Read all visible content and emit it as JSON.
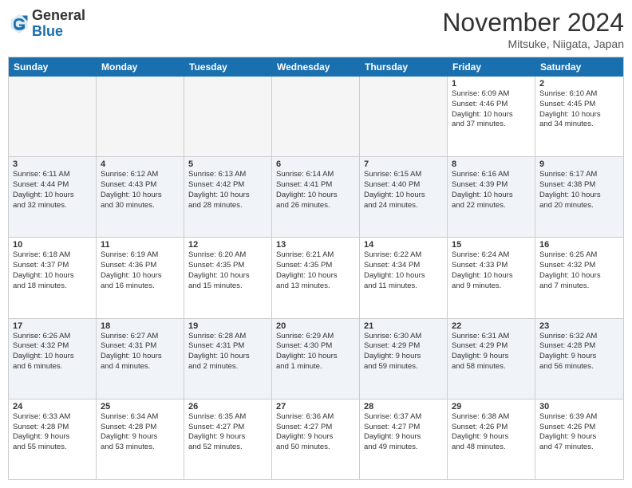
{
  "logo": {
    "general": "General",
    "blue": "Blue"
  },
  "header": {
    "title": "November 2024",
    "subtitle": "Mitsuke, Niigata, Japan"
  },
  "calendar": {
    "days": [
      "Sunday",
      "Monday",
      "Tuesday",
      "Wednesday",
      "Thursday",
      "Friday",
      "Saturday"
    ],
    "rows": [
      [
        {
          "day": "",
          "info": "",
          "empty": true
        },
        {
          "day": "",
          "info": "",
          "empty": true
        },
        {
          "day": "",
          "info": "",
          "empty": true
        },
        {
          "day": "",
          "info": "",
          "empty": true
        },
        {
          "day": "",
          "info": "",
          "empty": true
        },
        {
          "day": "1",
          "info": "Sunrise: 6:09 AM\nSunset: 4:46 PM\nDaylight: 10 hours\nand 37 minutes.",
          "empty": false
        },
        {
          "day": "2",
          "info": "Sunrise: 6:10 AM\nSunset: 4:45 PM\nDaylight: 10 hours\nand 34 minutes.",
          "empty": false
        }
      ],
      [
        {
          "day": "3",
          "info": "Sunrise: 6:11 AM\nSunset: 4:44 PM\nDaylight: 10 hours\nand 32 minutes.",
          "empty": false
        },
        {
          "day": "4",
          "info": "Sunrise: 6:12 AM\nSunset: 4:43 PM\nDaylight: 10 hours\nand 30 minutes.",
          "empty": false
        },
        {
          "day": "5",
          "info": "Sunrise: 6:13 AM\nSunset: 4:42 PM\nDaylight: 10 hours\nand 28 minutes.",
          "empty": false
        },
        {
          "day": "6",
          "info": "Sunrise: 6:14 AM\nSunset: 4:41 PM\nDaylight: 10 hours\nand 26 minutes.",
          "empty": false
        },
        {
          "day": "7",
          "info": "Sunrise: 6:15 AM\nSunset: 4:40 PM\nDaylight: 10 hours\nand 24 minutes.",
          "empty": false
        },
        {
          "day": "8",
          "info": "Sunrise: 6:16 AM\nSunset: 4:39 PM\nDaylight: 10 hours\nand 22 minutes.",
          "empty": false
        },
        {
          "day": "9",
          "info": "Sunrise: 6:17 AM\nSunset: 4:38 PM\nDaylight: 10 hours\nand 20 minutes.",
          "empty": false
        }
      ],
      [
        {
          "day": "10",
          "info": "Sunrise: 6:18 AM\nSunset: 4:37 PM\nDaylight: 10 hours\nand 18 minutes.",
          "empty": false
        },
        {
          "day": "11",
          "info": "Sunrise: 6:19 AM\nSunset: 4:36 PM\nDaylight: 10 hours\nand 16 minutes.",
          "empty": false
        },
        {
          "day": "12",
          "info": "Sunrise: 6:20 AM\nSunset: 4:35 PM\nDaylight: 10 hours\nand 15 minutes.",
          "empty": false
        },
        {
          "day": "13",
          "info": "Sunrise: 6:21 AM\nSunset: 4:35 PM\nDaylight: 10 hours\nand 13 minutes.",
          "empty": false
        },
        {
          "day": "14",
          "info": "Sunrise: 6:22 AM\nSunset: 4:34 PM\nDaylight: 10 hours\nand 11 minutes.",
          "empty": false
        },
        {
          "day": "15",
          "info": "Sunrise: 6:24 AM\nSunset: 4:33 PM\nDaylight: 10 hours\nand 9 minutes.",
          "empty": false
        },
        {
          "day": "16",
          "info": "Sunrise: 6:25 AM\nSunset: 4:32 PM\nDaylight: 10 hours\nand 7 minutes.",
          "empty": false
        }
      ],
      [
        {
          "day": "17",
          "info": "Sunrise: 6:26 AM\nSunset: 4:32 PM\nDaylight: 10 hours\nand 6 minutes.",
          "empty": false
        },
        {
          "day": "18",
          "info": "Sunrise: 6:27 AM\nSunset: 4:31 PM\nDaylight: 10 hours\nand 4 minutes.",
          "empty": false
        },
        {
          "day": "19",
          "info": "Sunrise: 6:28 AM\nSunset: 4:31 PM\nDaylight: 10 hours\nand 2 minutes.",
          "empty": false
        },
        {
          "day": "20",
          "info": "Sunrise: 6:29 AM\nSunset: 4:30 PM\nDaylight: 10 hours\nand 1 minute.",
          "empty": false
        },
        {
          "day": "21",
          "info": "Sunrise: 6:30 AM\nSunset: 4:29 PM\nDaylight: 9 hours\nand 59 minutes.",
          "empty": false
        },
        {
          "day": "22",
          "info": "Sunrise: 6:31 AM\nSunset: 4:29 PM\nDaylight: 9 hours\nand 58 minutes.",
          "empty": false
        },
        {
          "day": "23",
          "info": "Sunrise: 6:32 AM\nSunset: 4:28 PM\nDaylight: 9 hours\nand 56 minutes.",
          "empty": false
        }
      ],
      [
        {
          "day": "24",
          "info": "Sunrise: 6:33 AM\nSunset: 4:28 PM\nDaylight: 9 hours\nand 55 minutes.",
          "empty": false
        },
        {
          "day": "25",
          "info": "Sunrise: 6:34 AM\nSunset: 4:28 PM\nDaylight: 9 hours\nand 53 minutes.",
          "empty": false
        },
        {
          "day": "26",
          "info": "Sunrise: 6:35 AM\nSunset: 4:27 PM\nDaylight: 9 hours\nand 52 minutes.",
          "empty": false
        },
        {
          "day": "27",
          "info": "Sunrise: 6:36 AM\nSunset: 4:27 PM\nDaylight: 9 hours\nand 50 minutes.",
          "empty": false
        },
        {
          "day": "28",
          "info": "Sunrise: 6:37 AM\nSunset: 4:27 PM\nDaylight: 9 hours\nand 49 minutes.",
          "empty": false
        },
        {
          "day": "29",
          "info": "Sunrise: 6:38 AM\nSunset: 4:26 PM\nDaylight: 9 hours\nand 48 minutes.",
          "empty": false
        },
        {
          "day": "30",
          "info": "Sunrise: 6:39 AM\nSunset: 4:26 PM\nDaylight: 9 hours\nand 47 minutes.",
          "empty": false
        }
      ]
    ]
  }
}
